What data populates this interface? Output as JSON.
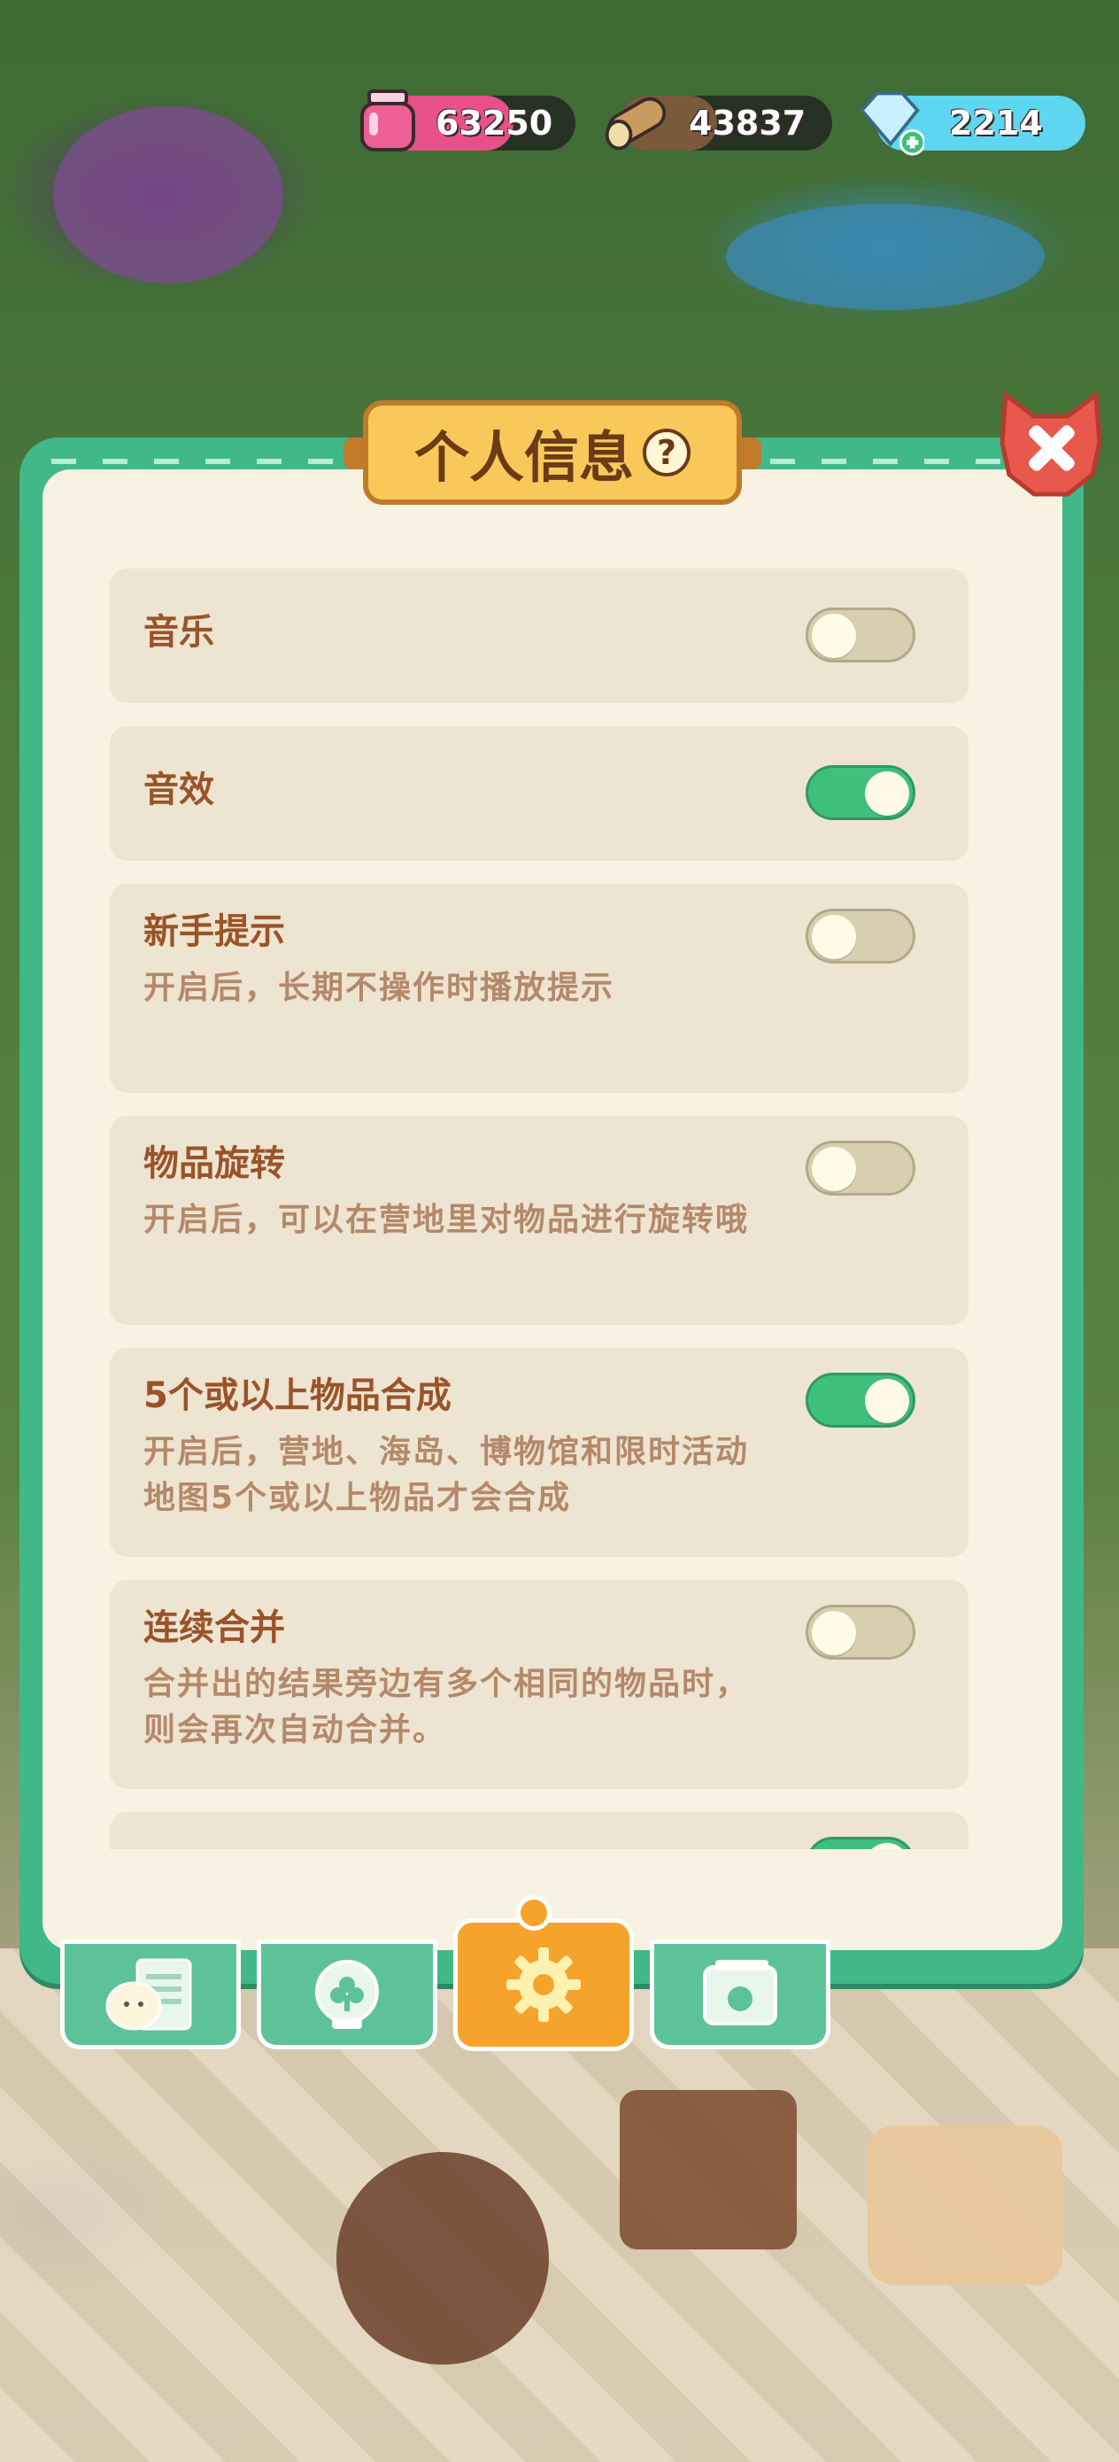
{
  "resources": [
    {
      "name": "potion",
      "value": "63250",
      "color": "#e8508a",
      "icon": "potion-icon"
    },
    {
      "name": "wood",
      "value": "43837",
      "color": "#7a5a3a",
      "icon": "wood-icon"
    },
    {
      "name": "gems",
      "value": "2214",
      "color": "#5fd6f0",
      "icon": "gem-plus-icon"
    }
  ],
  "dialog": {
    "title": "个人信息",
    "help_symbol": "?",
    "close_icon": "close-icon"
  },
  "settings": [
    {
      "title": "音乐",
      "desc": "",
      "enabled": false
    },
    {
      "title": "音效",
      "desc": "",
      "enabled": true
    },
    {
      "title": "新手提示",
      "desc": "开启后，长期不操作时播放提示",
      "enabled": false
    },
    {
      "title": "物品旋转",
      "desc": "开启后，可以在营地里对物品进行旋转哦",
      "enabled": false
    },
    {
      "title": "5个或以上物品合成",
      "desc": "开启后，营地、海岛、博物馆和限时活动地图5个或以上物品才会合成",
      "enabled": true
    },
    {
      "title": "连续合并",
      "desc": "合并出的结果旁边有多个相同的物品时，则会再次自动合并。",
      "enabled": false
    },
    {
      "title": "",
      "desc": "",
      "enabled": true
    }
  ],
  "tabs": [
    {
      "icon": "profile-card-icon",
      "active": false
    },
    {
      "icon": "badge-icon",
      "active": false
    },
    {
      "icon": "settings-gear-icon",
      "active": true
    },
    {
      "icon": "album-icon",
      "active": false
    }
  ],
  "colors": {
    "panel_green": "#41b888",
    "panel_bg": "#f8f2e3",
    "item_bg": "#ede4d1",
    "title_brown": "#9a5328",
    "desc_brown": "#b4886a",
    "toggle_on": "#3fbf7c",
    "active_tab": "#f6a32c"
  }
}
